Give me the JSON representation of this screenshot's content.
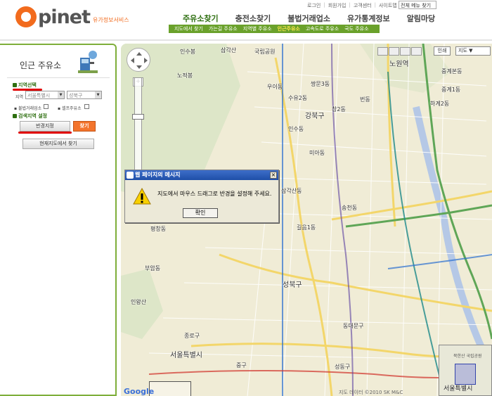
{
  "header": {
    "logo_text": "pinet",
    "logo_sub": "유가정보서비스",
    "util_links": [
      "로그인",
      "회원가입",
      "고객센터",
      "사이트맵"
    ],
    "menu_select": "전체 메뉴 찾기",
    "nav": [
      "주유소찾기",
      "충전소찾기",
      "불법거래업소",
      "유가통계정보",
      "알림마당"
    ],
    "sub_nav": [
      "지도에서 찾기",
      "가는길 주유소",
      "지역별 주유소",
      "인근주유소",
      "고속도로 주유소",
      "국도 주유소"
    ]
  },
  "sidebar": {
    "title": "인근 주유소",
    "region_section": "지역선택",
    "region_label": "지역",
    "city_select": "서울특별시",
    "district_select": "성북구",
    "illegal_label": "불법거래업소",
    "self_label": "셀프주유소",
    "search_section": "검색지역 설정",
    "radius_btn": "반경지정",
    "search_btn": "찾기",
    "current_map_btn": "현재지도에서 찾기"
  },
  "map": {
    "print_btn": "인쇄",
    "map_type_select": "지도",
    "labels": [
      "인수봉",
      "삼각산",
      "국립공원",
      "노원역",
      "중계본동",
      "중계1동",
      "하계2동",
      "노적봉",
      "우이동",
      "쌍문3동",
      "번동",
      "창2동",
      "수유2동",
      "강북구",
      "인수동",
      "미아동",
      "삼각산동",
      "송천동",
      "길음1동",
      "평창동",
      "성북구",
      "부암동",
      "인왕산",
      "동대문구",
      "종로구",
      "서울특별시",
      "성동구",
      "중구"
    ],
    "overview_top": "북한산 국립공원",
    "overview_label": "서울특별시",
    "google": "Google",
    "copyright": "지도 데이터 ©2010 SK M&C"
  },
  "dialog": {
    "title": "웹 페이지의 메시지",
    "close": "×",
    "message": "지도에서 마우스 드래그로 반경을 설정해 주세요.",
    "ok": "확인"
  }
}
